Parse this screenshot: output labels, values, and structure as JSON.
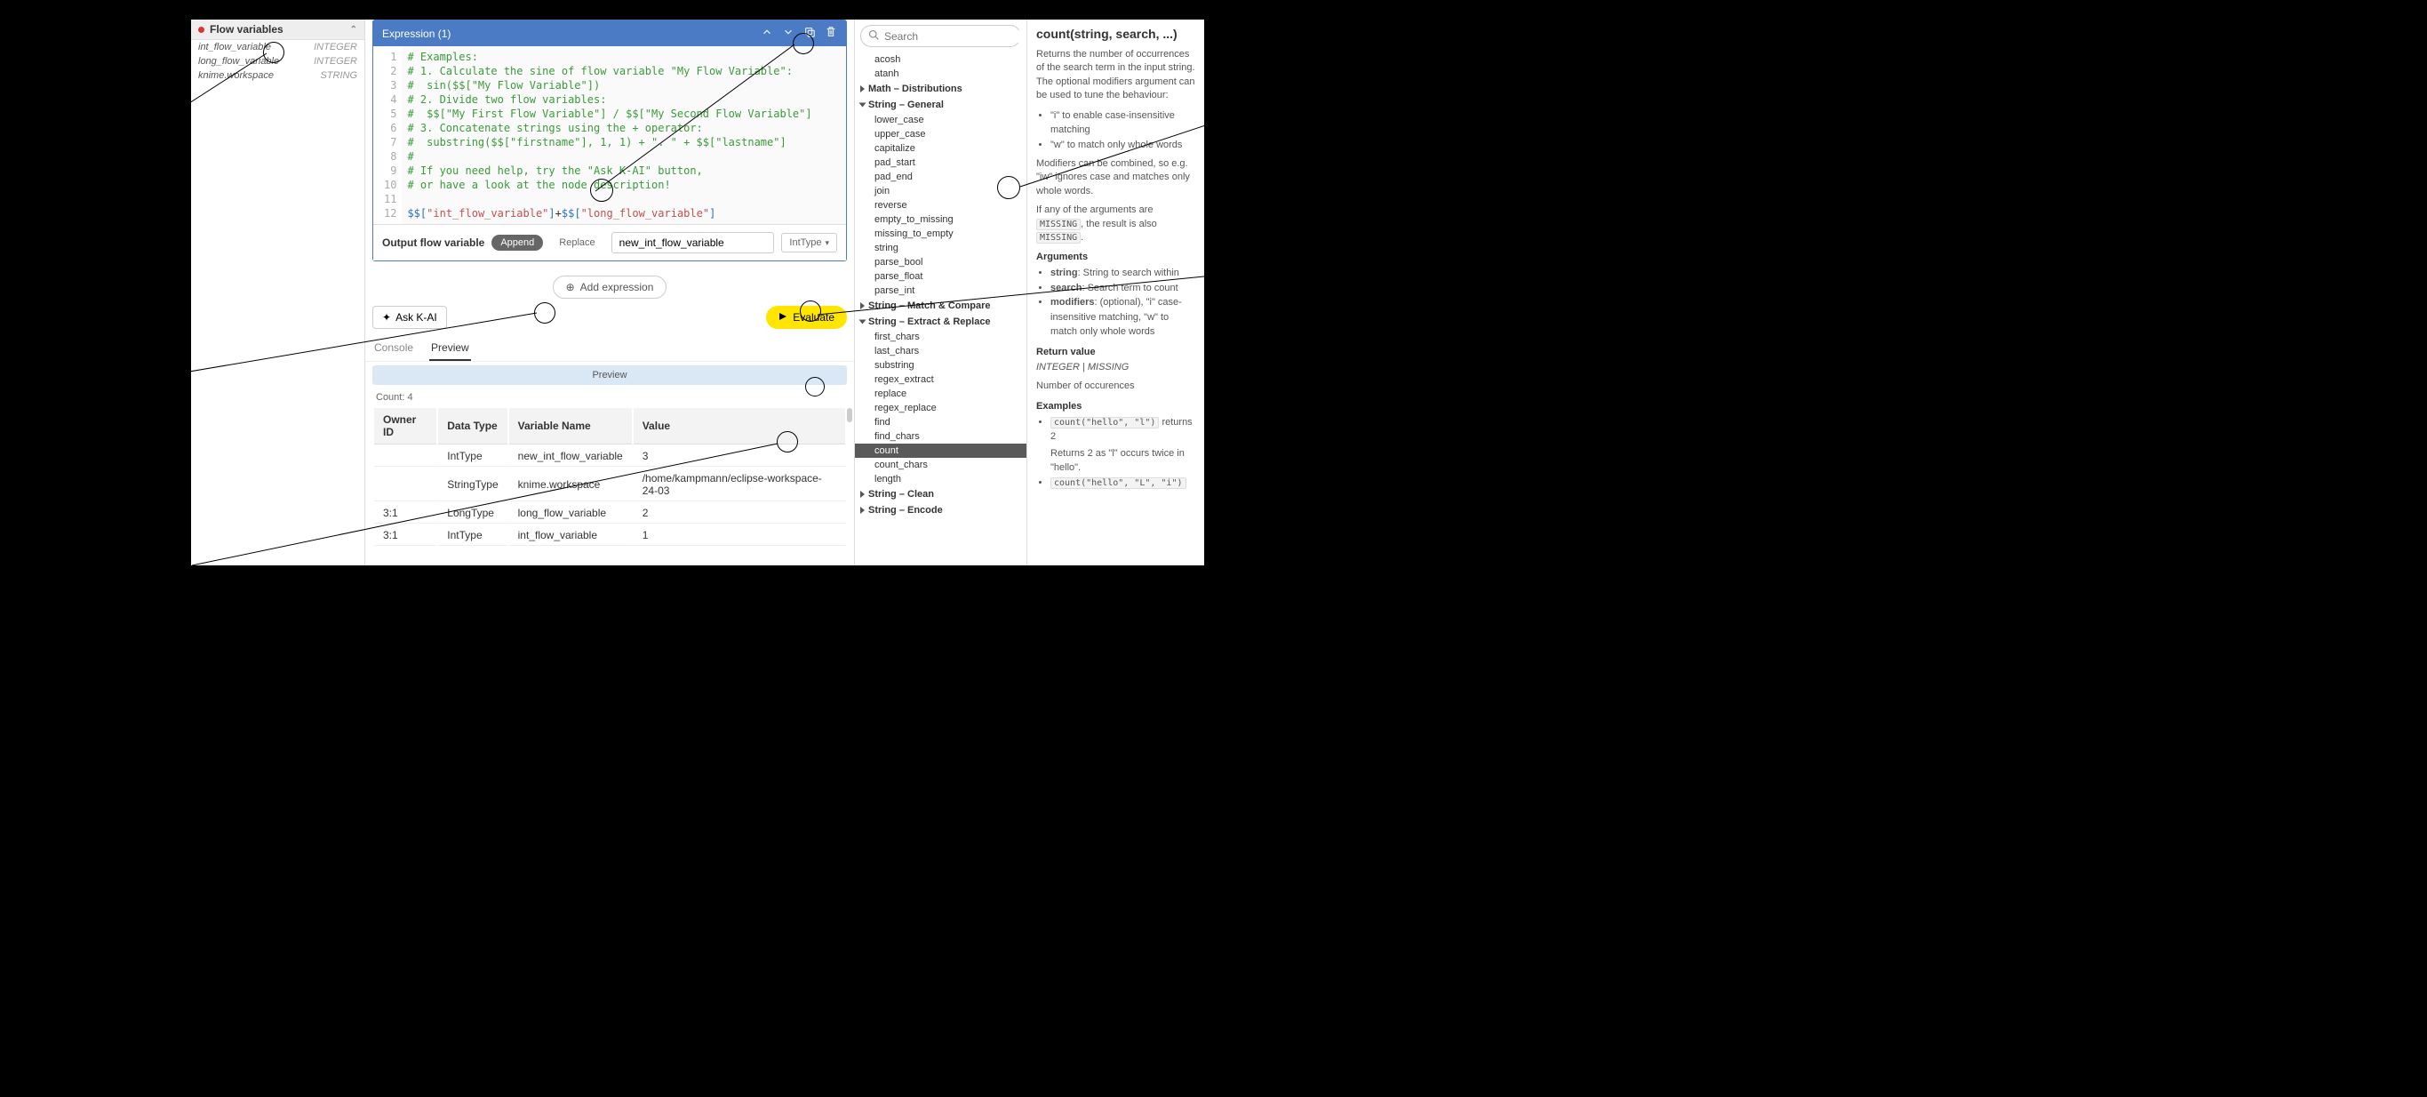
{
  "sidebar": {
    "title": "Flow variables",
    "items": [
      {
        "name": "int_flow_variable",
        "type": "INTEGER"
      },
      {
        "name": "long_flow_variable",
        "type": "INTEGER"
      },
      {
        "name": "knime.workspace",
        "type": "STRING"
      }
    ]
  },
  "editor": {
    "title": "Expression (1)",
    "lines": [
      {
        "n": "1",
        "t": "# Examples:",
        "c": "cm-comment"
      },
      {
        "n": "2",
        "t": "# 1. Calculate the sine of flow variable \"My Flow Variable\":",
        "c": "cm-comment"
      },
      {
        "n": "3",
        "t": "#  sin($$[\"My Flow Variable\"])",
        "c": "cm-comment"
      },
      {
        "n": "4",
        "t": "# 2. Divide two flow variables:",
        "c": "cm-comment"
      },
      {
        "n": "5",
        "t": "#  $$[\"My First Flow Variable\"] / $$[\"My Second Flow Variable\"]",
        "c": "cm-comment"
      },
      {
        "n": "6",
        "t": "# 3. Concatenate strings using the + operator:",
        "c": "cm-comment"
      },
      {
        "n": "7",
        "t": "#  substring($$[\"firstname\"], 1, 1) + \". \" + $$[\"lastname\"]",
        "c": "cm-comment"
      },
      {
        "n": "8",
        "t": "#",
        "c": "cm-comment"
      },
      {
        "n": "9",
        "t": "# If you need help, try the \"Ask K-AI\" button,",
        "c": "cm-comment"
      },
      {
        "n": "10",
        "t": "# or have a look at the node description!",
        "c": "cm-comment"
      },
      {
        "n": "11",
        "t": "",
        "c": ""
      },
      {
        "n": "12",
        "html": "<span class='cm-var'>$$[</span><span class='cm-str'>\"int_flow_variable\"</span><span class='cm-var'>]</span>+<span class='cm-var'>$$[</span><span class='cm-str'>\"long_flow_variable\"</span><span class='cm-var'>]</span>"
      }
    ],
    "output_label": "Output flow variable",
    "append": "Append",
    "replace": "Replace",
    "output_name": "new_int_flow_variable",
    "output_type": "IntType"
  },
  "add_expr": "Add expression",
  "ask_ai": "Ask K-AI",
  "evaluate": "Evaluate",
  "tabs": {
    "console": "Console",
    "preview": "Preview"
  },
  "preview_banner": "Preview",
  "count_label": "Count: 4",
  "table": {
    "headers": [
      "Owner ID",
      "Data Type",
      "Variable Name",
      "Value"
    ],
    "rows": [
      [
        "",
        "IntType",
        "new_int_flow_variable",
        "3"
      ],
      [
        "",
        "StringType",
        "knime.workspace",
        "/home/kampmann/eclipse-workspace-24-03"
      ],
      [
        "3:1",
        "LongType",
        "long_flow_variable",
        "2"
      ],
      [
        "3:1",
        "IntType",
        "int_flow_variable",
        "1"
      ]
    ]
  },
  "search_placeholder": "Search",
  "fn_tree": [
    {
      "type": "item",
      "label": "acosh"
    },
    {
      "type": "item",
      "label": "atanh"
    },
    {
      "type": "cat",
      "label": "Math – Distributions",
      "open": false
    },
    {
      "type": "cat",
      "label": "String – General",
      "open": true
    },
    {
      "type": "item",
      "label": "lower_case"
    },
    {
      "type": "item",
      "label": "upper_case"
    },
    {
      "type": "item",
      "label": "capitalize"
    },
    {
      "type": "item",
      "label": "pad_start"
    },
    {
      "type": "item",
      "label": "pad_end"
    },
    {
      "type": "item",
      "label": "join"
    },
    {
      "type": "item",
      "label": "reverse"
    },
    {
      "type": "item",
      "label": "empty_to_missing"
    },
    {
      "type": "item",
      "label": "missing_to_empty"
    },
    {
      "type": "item",
      "label": "string"
    },
    {
      "type": "item",
      "label": "parse_bool"
    },
    {
      "type": "item",
      "label": "parse_float"
    },
    {
      "type": "item",
      "label": "parse_int"
    },
    {
      "type": "cat",
      "label": "String – Match & Compare",
      "open": false
    },
    {
      "type": "cat",
      "label": "String – Extract & Replace",
      "open": true
    },
    {
      "type": "item",
      "label": "first_chars"
    },
    {
      "type": "item",
      "label": "last_chars"
    },
    {
      "type": "item",
      "label": "substring"
    },
    {
      "type": "item",
      "label": "regex_extract"
    },
    {
      "type": "item",
      "label": "replace"
    },
    {
      "type": "item",
      "label": "regex_replace"
    },
    {
      "type": "item",
      "label": "find"
    },
    {
      "type": "item",
      "label": "find_chars"
    },
    {
      "type": "item",
      "label": "count",
      "selected": true
    },
    {
      "type": "item",
      "label": "count_chars"
    },
    {
      "type": "item",
      "label": "length"
    },
    {
      "type": "cat",
      "label": "String – Clean",
      "open": false
    },
    {
      "type": "cat",
      "label": "String – Encode",
      "open": false
    }
  ],
  "doc": {
    "title": "count(string, search, ...)",
    "intro": "Returns the number of occurrences of the search term in the input string. The optional modifiers argument can be used to tune the behaviour:",
    "mods": [
      "\"i\" to enable case-insensitive matching",
      "\"w\" to match only whole words"
    ],
    "combine": "Modifiers can be combined, so e.g. \"iw\" ignores case and matches only whole words.",
    "missing_pre": "If any of the arguments are ",
    "missing_mid": "MISSING",
    "missing_post": ", the result is also ",
    "args_h": "Arguments",
    "args": [
      {
        "n": "string",
        "d": ": String to search within"
      },
      {
        "n": "search",
        "d": ": Search term to count"
      },
      {
        "n": "modifiers",
        "d": ": (optional), \"i\" case-insensitive matching, \"w\" to match only whole words"
      }
    ],
    "ret_h": "Return value",
    "ret_t": "INTEGER | MISSING",
    "ret_d": "Number of occurences",
    "ex_h": "Examples",
    "ex1_code": "count(\"hello\", \"l\")",
    "ex1_ret": " returns 2",
    "ex1_desc": "Returns 2 as \"l\" occurs twice in \"hello\".",
    "ex2_code": "count(\"hello\", \"L\", \"i\")"
  }
}
